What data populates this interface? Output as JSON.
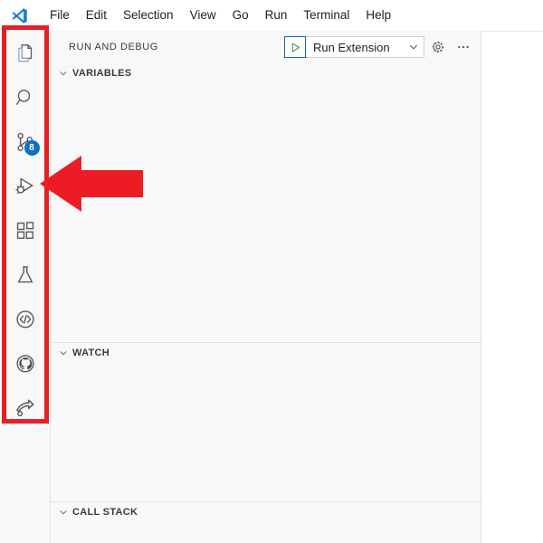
{
  "window": {
    "logo_icon": "vscode-logo"
  },
  "menubar": {
    "items": [
      {
        "label": "File"
      },
      {
        "label": "Edit"
      },
      {
        "label": "Selection"
      },
      {
        "label": "View"
      },
      {
        "label": "Go"
      },
      {
        "label": "Run"
      },
      {
        "label": "Terminal"
      },
      {
        "label": "Help"
      }
    ]
  },
  "activitybar": {
    "items": [
      {
        "name": "explorer",
        "icon": "files-icon",
        "badge": ""
      },
      {
        "name": "search",
        "icon": "search-icon",
        "badge": ""
      },
      {
        "name": "source-control",
        "icon": "source-control-icon",
        "badge": "8"
      },
      {
        "name": "run-and-debug",
        "icon": "run-and-debug-icon",
        "badge": ""
      },
      {
        "name": "extensions",
        "icon": "extensions-icon",
        "badge": ""
      },
      {
        "name": "testing",
        "icon": "beaker-icon",
        "badge": ""
      },
      {
        "name": "remote-explorer",
        "icon": "code-brackets-circle-icon",
        "badge": ""
      },
      {
        "name": "github",
        "icon": "github-icon",
        "badge": ""
      },
      {
        "name": "live-share",
        "icon": "share-arrow-icon",
        "badge": ""
      }
    ]
  },
  "sidebar": {
    "title": "RUN AND DEBUG",
    "run_control": {
      "play_icon": "play-triangle-icon",
      "configuration": "Run Extension",
      "chevron_icon": "chevron-down-icon"
    },
    "actions": [
      {
        "name": "open-launch-config",
        "icon": "gear-icon"
      },
      {
        "name": "more-actions",
        "icon": "ellipsis-icon"
      }
    ],
    "sections": [
      {
        "name": "variables",
        "label": "VARIABLES",
        "twisty": "chevron-down-icon"
      },
      {
        "name": "watch",
        "label": "WATCH",
        "twisty": "chevron-down-icon"
      },
      {
        "name": "call-stack",
        "label": "CALL STACK",
        "twisty": "chevron-down-icon"
      }
    ]
  },
  "annotations": {
    "highlight_rect": {
      "name": "activity-bar-highlight",
      "color": "#e81e25"
    },
    "pointer_arrow": {
      "name": "pointer-arrow-to-run-and-debug",
      "color": "#ed1c24",
      "direction": "left"
    }
  },
  "colors": {
    "accent_blue": "#0e70c0",
    "annotation_red": "#e81e25",
    "play_green": "#3c9a3c",
    "sidebar_bg": "#f8f8f8",
    "editor_bg": "#ffffff"
  }
}
